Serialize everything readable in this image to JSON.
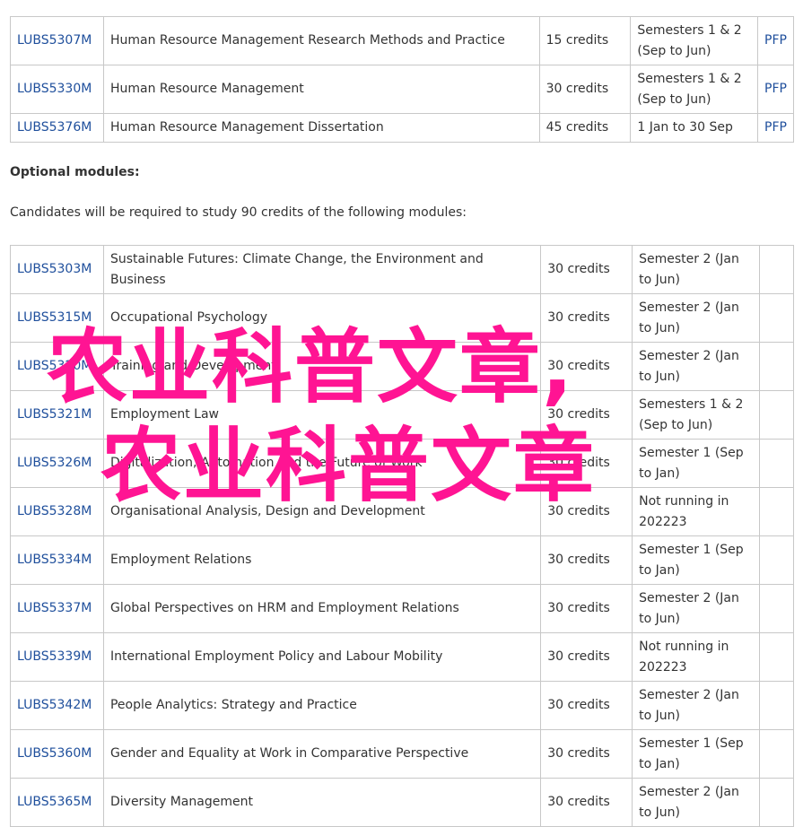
{
  "core_modules": [
    {
      "code": "LUBS5307M",
      "title": "Human Resource Management Research Methods and Practice",
      "credits": "15 credits",
      "semester": "Semesters 1 & 2 (Sep to Jun)",
      "pfp": "PFP"
    },
    {
      "code": "LUBS5330M",
      "title": "Human Resource Management",
      "credits": "30 credits",
      "semester": "Semesters 1 & 2 (Sep to Jun)",
      "pfp": "PFP"
    },
    {
      "code": "LUBS5376M",
      "title": "Human Resource Management Dissertation",
      "credits": "45 credits",
      "semester": "1 Jan to 30 Sep",
      "pfp": "PFP"
    }
  ],
  "optional_heading": "Optional modules:",
  "optional_intro": "Candidates will be required to study 90 credits of the following modules:",
  "optional_modules": [
    {
      "code": "LUBS5303M",
      "title": "Sustainable Futures: Climate Change, the Environment and Business",
      "credits": "30 credits",
      "semester": "Semester 2 (Jan to Jun)"
    },
    {
      "code": "LUBS5315M",
      "title": "Occupational Psychology",
      "credits": "30 credits",
      "semester": "Semester 2 (Jan to Jun)"
    },
    {
      "code": "LUBS5320M",
      "title": "Training and Development",
      "credits": "30 credits",
      "semester": "Semester 2 (Jan to Jun)"
    },
    {
      "code": "LUBS5321M",
      "title": "Employment Law",
      "credits": "30 credits",
      "semester": "Semesters 1 & 2 (Sep to Jun)"
    },
    {
      "code": "LUBS5326M",
      "title": "Digitalization, Automation and the Future of Work",
      "credits": "30 credits",
      "semester": "Semester 1 (Sep to Jan)"
    },
    {
      "code": "LUBS5328M",
      "title": "Organisational Analysis, Design and Development",
      "credits": "30 credits",
      "semester": "Not running in 202223"
    },
    {
      "code": "LUBS5334M",
      "title": "Employment Relations",
      "credits": "30 credits",
      "semester": "Semester 1 (Sep to Jan)"
    },
    {
      "code": "LUBS5337M",
      "title": "Global Perspectives on HRM and Employment Relations",
      "credits": "30 credits",
      "semester": "Semester 2 (Jan to Jun)"
    },
    {
      "code": "LUBS5339M",
      "title": "International Employment Policy and Labour Mobility",
      "credits": "30 credits",
      "semester": "Not running in 202223"
    },
    {
      "code": "LUBS5342M",
      "title": "People Analytics: Strategy and Practice",
      "credits": "30 credits",
      "semester": "Semester 2 (Jan to Jun)"
    },
    {
      "code": "LUBS5360M",
      "title": "Gender and Equality at Work in Comparative Perspective",
      "credits": "30 credits",
      "semester": "Semester 1 (Sep to Jan)"
    },
    {
      "code": "LUBS5365M",
      "title": "Diversity Management",
      "credits": "30 credits",
      "semester": "Semester 2 (Jan to Jun)"
    }
  ],
  "watermark": {
    "line1": "农业科普文章,",
    "line2": "农业科普文章",
    "color": "#ff1493"
  }
}
